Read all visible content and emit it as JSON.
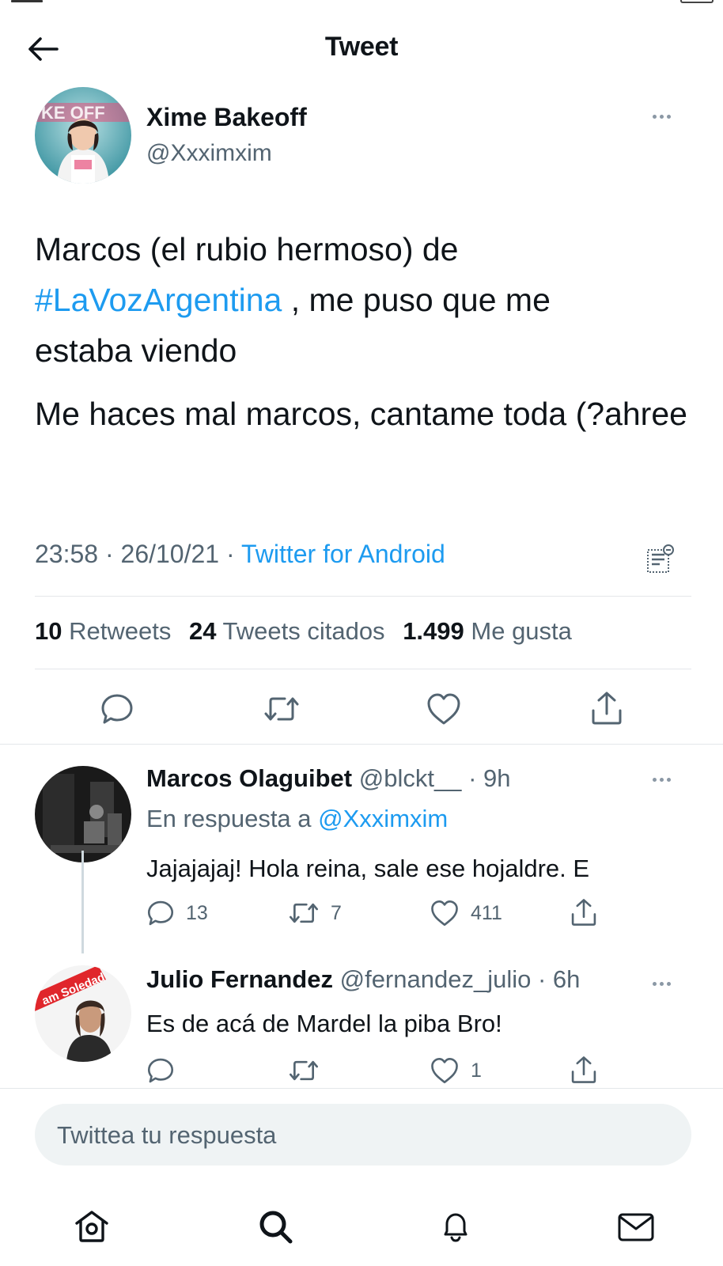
{
  "header": {
    "title": "Tweet",
    "back_icon": "arrow-left-icon"
  },
  "tweet": {
    "author_name": "Xime Bakeoff",
    "author_handle": "@Xxximxim",
    "text_line1": "Marcos (el rubio hermoso) de",
    "hashtag": "#LaVozArgentina",
    "text_line2_rest": " , me puso que me",
    "text_line3": "estaba viendo",
    "text_para2": "Me haces mal marcos, cantame toda (?ahree",
    "time": "23:58",
    "date": "26/10/21",
    "source": "Twitter for Android",
    "separator": "·"
  },
  "stats": {
    "retweets_count": "10",
    "retweets_label": "Retweets",
    "quotes_count": "24",
    "quotes_label": "Tweets citados",
    "likes_count": "1.499",
    "likes_label": "Me gusta"
  },
  "replies": [
    {
      "name": "Marcos Olaguibet",
      "handle": "@blckt__",
      "time": "9h",
      "reply_to_label": "En respuesta a",
      "reply_to_handle": "@Xxximxim",
      "text": "Jajajajaj! Hola reina, sale ese hojaldre. E",
      "reply_count": "13",
      "retweet_count": "7",
      "like_count": "411",
      "separator": "·"
    },
    {
      "name": "Julio Fernandez",
      "handle": "@fernandez_julio",
      "time": "6h",
      "text": "Es de acá de Mardel la piba Bro!",
      "reply_count": "",
      "retweet_count": "",
      "like_count": "1",
      "separator": "·"
    }
  ],
  "compose": {
    "placeholder": "Twittea tu respuesta"
  },
  "nav": [
    "home-icon",
    "search-icon",
    "notifications-bell-icon",
    "messages-envelope-icon"
  ],
  "colors": {
    "accent": "#1d9bf0",
    "text": "#0f1419",
    "secondary": "#536471",
    "divider": "#e4e7ea",
    "compose_bg": "#eff3f4"
  }
}
